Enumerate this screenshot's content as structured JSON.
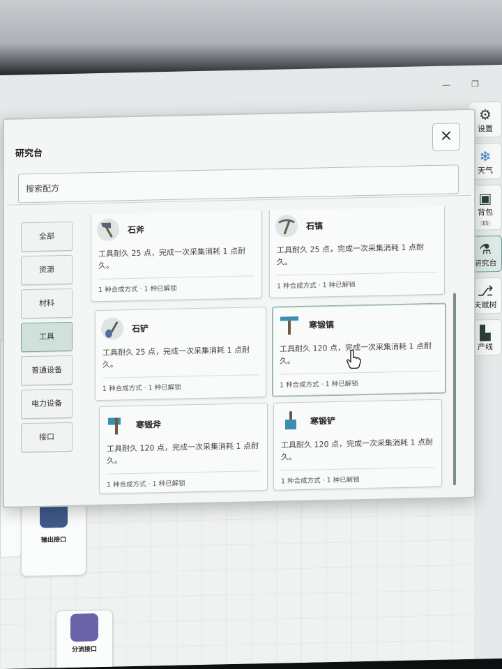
{
  "rail": {
    "settings": "设置",
    "weather": "天气",
    "backpack": "背包",
    "backpack_count": "11",
    "research": "研究台",
    "talent_tree": "天赋树",
    "production": "产线"
  },
  "dialog": {
    "title": "研究台",
    "search_placeholder": "搜索配方",
    "close_label": "×"
  },
  "categories": [
    {
      "label": "全部",
      "active": false
    },
    {
      "label": "资源",
      "active": false
    },
    {
      "label": "材料",
      "active": false
    },
    {
      "label": "工具",
      "active": true
    },
    {
      "label": "普通设备",
      "active": false
    },
    {
      "label": "电力设备",
      "active": false
    },
    {
      "label": "接口",
      "active": false
    }
  ],
  "recipes": [
    {
      "name": "石斧",
      "description": "工具耐久 25 点，完成一次采集消耗 1 点耐久。",
      "footer": "1 种合成方式 · 1 种已解锁",
      "icon": "stone-axe-icon"
    },
    {
      "name": "石镐",
      "description": "工具耐久 25 点，完成一次采集消耗 1 点耐久。",
      "footer": "1 种合成方式 · 1 种已解锁",
      "icon": "stone-pickaxe-icon"
    },
    {
      "name": "石铲",
      "description": "工具耐久 25 点，完成一次采集消耗 1 点耐久。",
      "footer": "1 种合成方式 · 1 种已解锁",
      "icon": "stone-shovel-icon"
    },
    {
      "name": "寒锻镐",
      "description": "工具耐久 120 点，完成一次采集消耗 1 点耐久。",
      "footer": "1 种合成方式 · 1 种已解锁",
      "icon": "frost-pickaxe-icon"
    },
    {
      "name": "寒锻斧",
      "description": "工具耐久 120 点，完成一次采集消耗 1 点耐久。",
      "footer": "1 种合成方式 · 1 种已解锁",
      "icon": "frost-axe-icon"
    },
    {
      "name": "寒锻铲",
      "description": "工具耐久 120 点，完成一次采集消耗 1 点耐久。",
      "footer": "1 种合成方式 · 1 种已解锁",
      "icon": "frost-shovel-icon"
    }
  ],
  "background": {
    "output_node_title": "输出接口",
    "split_node_title": "分流接口"
  },
  "colors": {
    "accent": "#6a9a8e",
    "active_category": "#cfe1d9",
    "frost_tool": "#3a8fb0",
    "stone_tool": "#5a6470"
  }
}
